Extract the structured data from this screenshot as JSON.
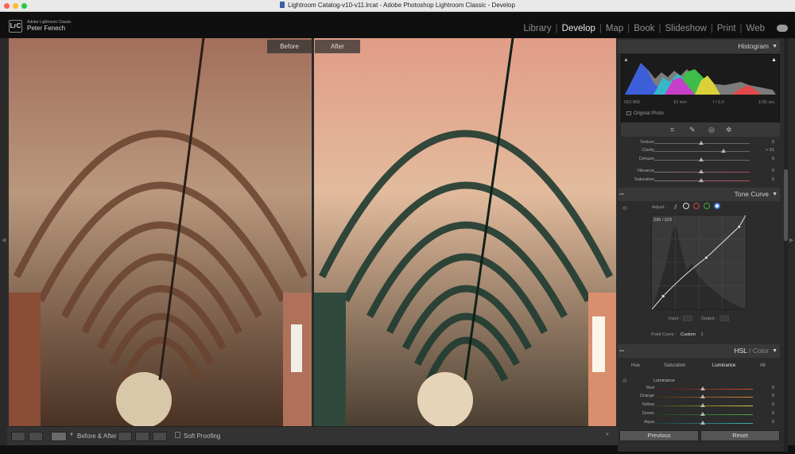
{
  "window": {
    "title": "Lightroom Catalog-v10-v11.lrcat - Adobe Photoshop Lightroom Classic - Develop",
    "traffic_colors": [
      "#fe5f57",
      "#febc2e",
      "#28c840"
    ]
  },
  "identity": {
    "logo": "LrC",
    "product": "Adobe Lightroom Classic",
    "user": "Peter Fenech"
  },
  "modules": [
    "Library",
    "Develop",
    "Map",
    "Book",
    "Slideshow",
    "Print",
    "Web"
  ],
  "active_module": "Develop",
  "view": {
    "before_label": "Before",
    "after_label": "After"
  },
  "toolbar": {
    "before_after_label": "Before & After :",
    "soft_proofing_label": "Soft Proofing"
  },
  "histogram": {
    "title": "Histogram",
    "iso": "ISO 800",
    "focal": "10 mm",
    "aperture": "f / 5.0",
    "shutter": "1/30 sec",
    "original_photo": "Original Photo"
  },
  "presence": [
    {
      "label": "Texture",
      "value": "0",
      "pos": 0.5
    },
    {
      "label": "Clarity",
      "value": "+ 51",
      "pos": 0.75
    },
    {
      "label": "Dehaze",
      "value": "0",
      "pos": 0.5
    },
    {
      "label": "Vibrance",
      "value": "0",
      "pos": 0.5
    },
    {
      "label": "Saturation",
      "value": "0",
      "pos": 0.5
    }
  ],
  "tone_curve": {
    "title": "Tone Curve",
    "adjust_label": "Adjust :",
    "readout": "236 / 223",
    "input_label": "Input :",
    "output_label": "Output :",
    "point_curve_label": "Point Curve :",
    "point_curve_value": "Custom",
    "curve_points": [
      [
        0,
        0
      ],
      [
        0.12,
        0.14
      ],
      [
        0.58,
        0.55
      ],
      [
        0.93,
        0.88
      ],
      [
        1,
        1
      ]
    ]
  },
  "hsl": {
    "title_hsl": "HSL",
    "title_color": "Color",
    "tabs": [
      "Hue",
      "Saturation",
      "Luminance",
      "All"
    ],
    "active_tab": "Luminance",
    "section_label": "Luminance",
    "rows": [
      {
        "label": "Red",
        "value": "0",
        "color": "#d64a3a"
      },
      {
        "label": "Orange",
        "value": "0",
        "color": "#e08a35"
      },
      {
        "label": "Yellow",
        "value": "0",
        "color": "#d8c93a"
      },
      {
        "label": "Green",
        "value": "0",
        "color": "#4aaa46"
      },
      {
        "label": "Aqua",
        "value": "0",
        "color": "#3ab3b3"
      }
    ]
  },
  "buttons": {
    "previous": "Previous",
    "reset": "Reset"
  }
}
